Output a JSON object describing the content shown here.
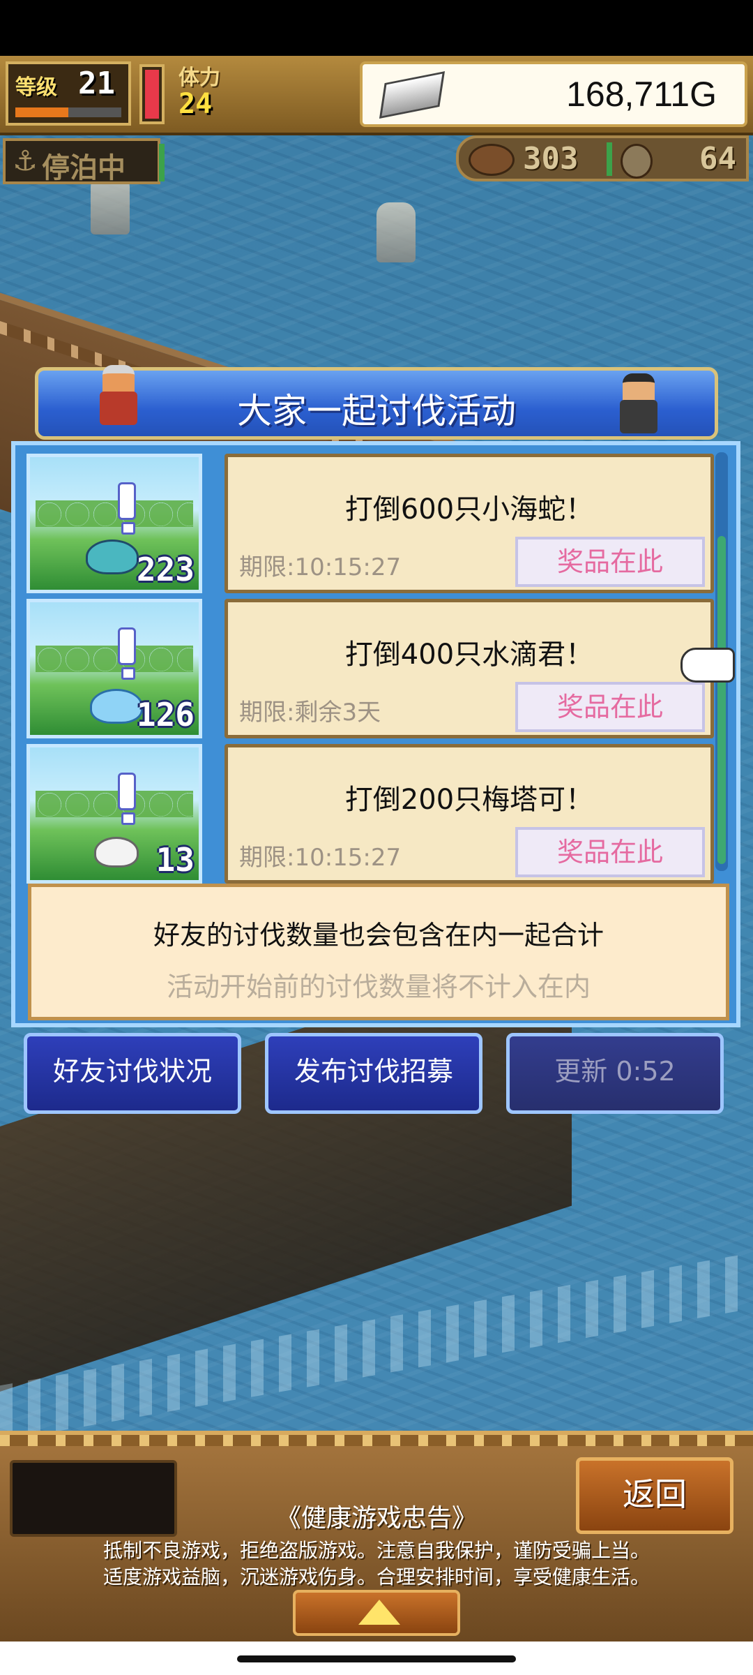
{
  "hud": {
    "level_label": "等级",
    "level": "21",
    "level_progress": 0.5,
    "hp_fill": 1.0,
    "stamina_label": "体力",
    "stamina": "24",
    "gold": "168,711G",
    "status": "停泊中",
    "resource1": "303",
    "resource2": "64"
  },
  "dialog": {
    "title": "大家一起讨伐活动",
    "quests": [
      {
        "title": "打倒600只小海蛇！",
        "deadline": "期限:10:15:27",
        "prize": "奖品在此",
        "count": "223",
        "monster": "sea-snake"
      },
      {
        "title": "打倒400只水滴君！",
        "deadline": "期限:剩余3天",
        "prize": "奖品在此",
        "count": "126",
        "monster": "water-drop"
      },
      {
        "title": "打倒200只梅塔可！",
        "deadline": "期限:10:15:27",
        "prize": "奖品在此",
        "count": "13",
        "monster": "metaco"
      }
    ],
    "note_main": "好友的讨伐数量也会包含在内一起合计",
    "note_sub": "活动开始前的讨伐数量将不计入在内",
    "buttons": {
      "friend_status": "好友讨伐状况",
      "publish_recruit": "发布讨伐招募",
      "refresh": "更新 0:52"
    }
  },
  "footer": {
    "back": "返回",
    "health_title": "《健康游戏忠告》",
    "health_line1": "抵制不良游戏，拒绝盗版游戏。注意自我保护，谨防受骗上当。",
    "health_line2": "适度游戏益脑，沉迷游戏伤身。合理安排时间，享受健康生活。"
  },
  "colors": {
    "title_bar": "#2b5fd0",
    "card_bg": "#f6e8c4",
    "prize_text": "#e56aa0",
    "button_bg": "#1d2a8c"
  }
}
